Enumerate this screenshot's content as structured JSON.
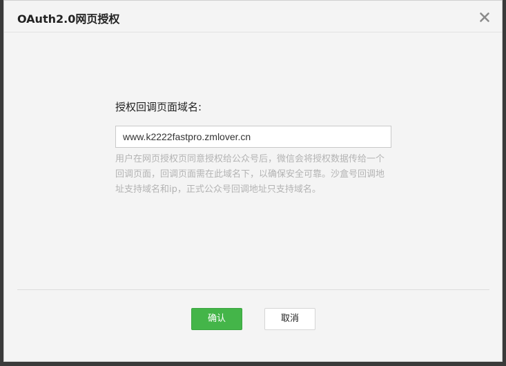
{
  "dialog": {
    "title": "OAuth2.0网页授权"
  },
  "form": {
    "label": "授权回调页面域名:",
    "domain_value": "www.k2222fastpro.zmlover.cn",
    "tip": "用户在网页授权页同意授权给公众号后，微信会将授权数据传给一个回调页面，回调页面需在此域名下，以确保安全可靠。沙盒号回调地址支持域名和ip，正式公众号回调地址只支持域名。"
  },
  "buttons": {
    "confirm": "确认",
    "cancel": "取消"
  },
  "colors": {
    "primary": "#44b549",
    "tip_text": "#b3b3b3"
  },
  "icons": {
    "close": "close-icon"
  }
}
